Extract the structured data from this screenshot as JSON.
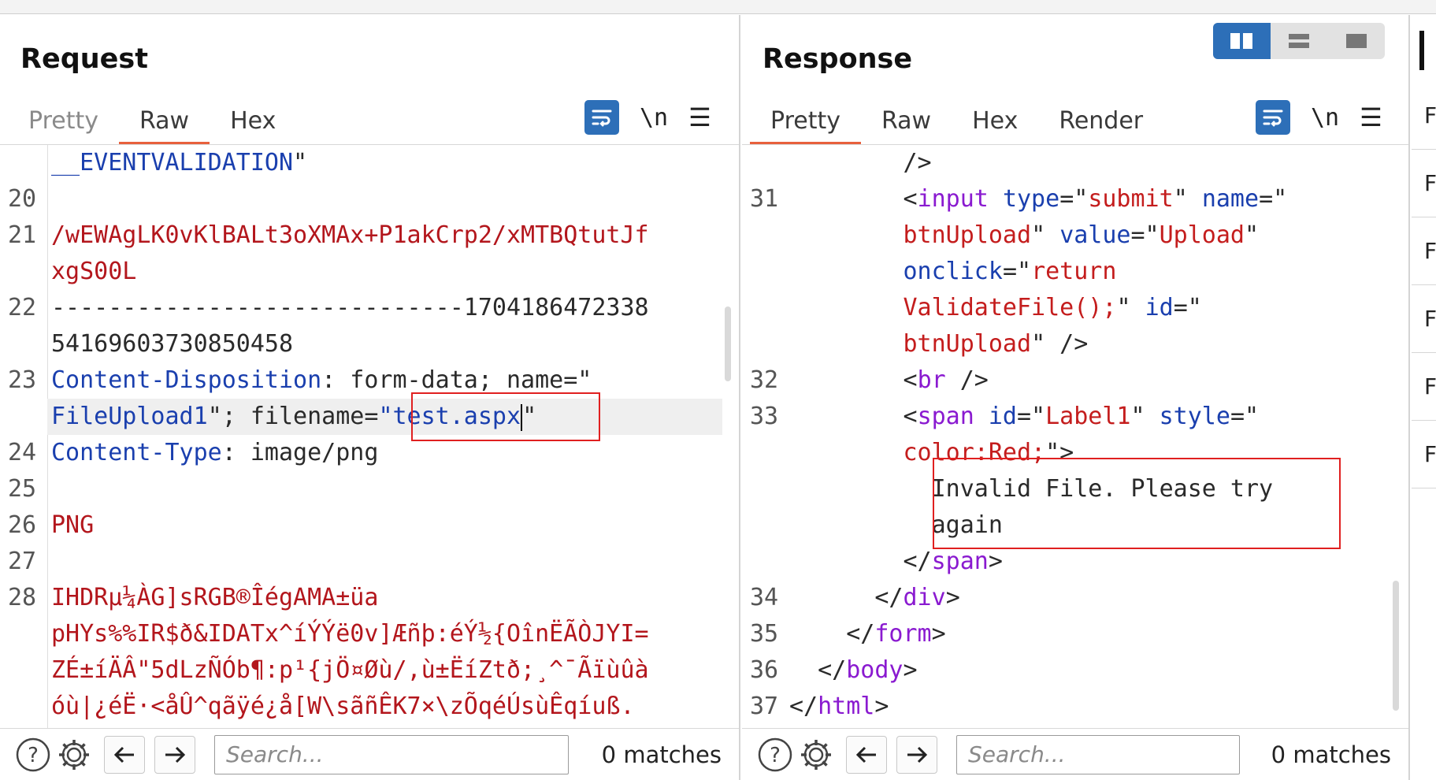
{
  "request": {
    "title": "Request",
    "tabs": [
      {
        "label": "Pretty",
        "state": "muted"
      },
      {
        "label": "Raw",
        "state": "active"
      },
      {
        "label": "Hex",
        "state": "normal"
      }
    ],
    "newline_label": "\\n",
    "lines": [
      {
        "num": "",
        "segments": [
          {
            "t": "__EVENTVALIDATION",
            "c": "blue"
          },
          {
            "t": "\"",
            "c": "dark"
          }
        ]
      },
      {
        "num": "20",
        "segments": []
      },
      {
        "num": "21",
        "segments": [
          {
            "t": "/wEWAgLK0vKlBALt3oXMAx+P1akCrp2/xMTBQtutJf",
            "c": "red"
          }
        ]
      },
      {
        "num": "",
        "segments": [
          {
            "t": "xgS00L",
            "c": "red"
          }
        ]
      },
      {
        "num": "22",
        "segments": [
          {
            "t": "-----------------------------1704186472338",
            "c": "dark"
          }
        ]
      },
      {
        "num": "",
        "segments": [
          {
            "t": "54169603730850458",
            "c": "dark"
          }
        ]
      },
      {
        "num": "23",
        "segments": [
          {
            "t": "Content-Disposition",
            "c": "blue"
          },
          {
            "t": ": form-data; name=\"",
            "c": "dark"
          }
        ]
      },
      {
        "num": "",
        "segments": [
          {
            "t": "FileUpload1",
            "c": "blue"
          },
          {
            "t": "\"; filename=",
            "c": "dark"
          },
          {
            "t": "\"test.aspx",
            "c": "blue"
          },
          {
            "t": "CARET",
            "c": "caret"
          },
          {
            "t": "\"",
            "c": "dark"
          }
        ]
      },
      {
        "num": "24",
        "segments": [
          {
            "t": "Content-Type",
            "c": "blue"
          },
          {
            "t": ": image/png",
            "c": "dark"
          }
        ]
      },
      {
        "num": "25",
        "segments": []
      },
      {
        "num": "26",
        "segments": [
          {
            "t": "PNG",
            "c": "red"
          }
        ]
      },
      {
        "num": "27",
        "segments": []
      },
      {
        "num": "28",
        "segments": [
          {
            "t": "IHDRµ¼ÀG]sRGB®ÎégAMA±üa",
            "c": "red"
          }
        ]
      },
      {
        "num": "",
        "segments": [
          {
            "t": "pHYs%%IR$ð&IDATx^íÝÝë0v]Æñþ:éÝ½{OînËÃÒJYI=",
            "c": "red"
          }
        ]
      },
      {
        "num": "",
        "segments": [
          {
            "t": "ZÉ±íÄÂ\"5dLzÑÓb¶:p¹{jÖ¤Øù/,ù±ËíZtð;¸^¯Ãïùûà",
            "c": "red"
          }
        ]
      },
      {
        "num": "",
        "segments": [
          {
            "t": "óù|¿éË·<åÛ^qãÿé¿å[W\\sãñÊK7×\\zÕqéÚsùÊqíuß.",
            "c": "red"
          }
        ]
      }
    ],
    "search_placeholder": "Search...",
    "matches": "0 matches"
  },
  "response": {
    "title": "Response",
    "tabs": [
      {
        "label": "Pretty",
        "state": "active"
      },
      {
        "label": "Raw",
        "state": "normal"
      },
      {
        "label": "Hex",
        "state": "normal"
      },
      {
        "label": "Render",
        "state": "normal"
      }
    ],
    "newline_label": "\\n",
    "lines": [
      {
        "num": "",
        "segments": [
          {
            "t": "        />",
            "c": "dark"
          }
        ]
      },
      {
        "num": "31",
        "segments": [
          {
            "t": "        <",
            "c": "dark"
          },
          {
            "t": "input",
            "c": "purple"
          },
          {
            "t": " ",
            "c": "dark"
          },
          {
            "t": "type",
            "c": "blue"
          },
          {
            "t": "=\"",
            "c": "dark"
          },
          {
            "t": "submit",
            "c": "redtxt"
          },
          {
            "t": "\" ",
            "c": "dark"
          },
          {
            "t": "name",
            "c": "blue"
          },
          {
            "t": "=\"",
            "c": "dark"
          }
        ]
      },
      {
        "num": "",
        "segments": [
          {
            "t": "        ",
            "c": "dark"
          },
          {
            "t": "btnUpload",
            "c": "redtxt"
          },
          {
            "t": "\" ",
            "c": "dark"
          },
          {
            "t": "value",
            "c": "blue"
          },
          {
            "t": "=\"",
            "c": "dark"
          },
          {
            "t": "Upload",
            "c": "redtxt"
          },
          {
            "t": "\"",
            "c": "dark"
          }
        ]
      },
      {
        "num": "",
        "segments": [
          {
            "t": "        ",
            "c": "dark"
          },
          {
            "t": "onclick",
            "c": "blue"
          },
          {
            "t": "=\"",
            "c": "dark"
          },
          {
            "t": "return",
            "c": "redtxt"
          }
        ]
      },
      {
        "num": "",
        "segments": [
          {
            "t": "        ",
            "c": "dark"
          },
          {
            "t": "ValidateFile();",
            "c": "redtxt"
          },
          {
            "t": "\" ",
            "c": "dark"
          },
          {
            "t": "id",
            "c": "blue"
          },
          {
            "t": "=\"",
            "c": "dark"
          }
        ]
      },
      {
        "num": "",
        "segments": [
          {
            "t": "        ",
            "c": "dark"
          },
          {
            "t": "btnUpload",
            "c": "redtxt"
          },
          {
            "t": "\" />",
            "c": "dark"
          }
        ]
      },
      {
        "num": "32",
        "segments": [
          {
            "t": "        <",
            "c": "dark"
          },
          {
            "t": "br",
            "c": "purple"
          },
          {
            "t": " />",
            "c": "dark"
          }
        ]
      },
      {
        "num": "33",
        "segments": [
          {
            "t": "        <",
            "c": "dark"
          },
          {
            "t": "span",
            "c": "purple"
          },
          {
            "t": " ",
            "c": "dark"
          },
          {
            "t": "id",
            "c": "blue"
          },
          {
            "t": "=\"",
            "c": "dark"
          },
          {
            "t": "Label1",
            "c": "redtxt"
          },
          {
            "t": "\" ",
            "c": "dark"
          },
          {
            "t": "style",
            "c": "blue"
          },
          {
            "t": "=\"",
            "c": "dark"
          }
        ]
      },
      {
        "num": "",
        "segments": [
          {
            "t": "        ",
            "c": "dark"
          },
          {
            "t": "color:Red;",
            "c": "redtxt"
          },
          {
            "t": "\">",
            "c": "dark"
          }
        ]
      },
      {
        "num": "",
        "segments": [
          {
            "t": "          Invalid File. Please try",
            "c": "dark"
          }
        ]
      },
      {
        "num": "",
        "segments": [
          {
            "t": "          again",
            "c": "dark"
          }
        ]
      },
      {
        "num": "",
        "segments": [
          {
            "t": "        </",
            "c": "dark"
          },
          {
            "t": "span",
            "c": "purple"
          },
          {
            "t": ">",
            "c": "dark"
          }
        ]
      },
      {
        "num": "34",
        "segments": [
          {
            "t": "      </",
            "c": "dark"
          },
          {
            "t": "div",
            "c": "purple"
          },
          {
            "t": ">",
            "c": "dark"
          }
        ]
      },
      {
        "num": "35",
        "segments": [
          {
            "t": "    </",
            "c": "dark"
          },
          {
            "t": "form",
            "c": "purple"
          },
          {
            "t": ">",
            "c": "dark"
          }
        ]
      },
      {
        "num": "36",
        "segments": [
          {
            "t": "  </",
            "c": "dark"
          },
          {
            "t": "body",
            "c": "purple"
          },
          {
            "t": ">",
            "c": "dark"
          }
        ]
      },
      {
        "num": "37",
        "segments": [
          {
            "t": "</",
            "c": "dark"
          },
          {
            "t": "html",
            "c": "purple"
          },
          {
            "t": ">",
            "c": "dark"
          }
        ]
      }
    ],
    "search_placeholder": "Search...",
    "matches": "0 matches"
  },
  "side_panel": {
    "items": [
      "F",
      "F",
      "F",
      "F",
      "F",
      "F"
    ]
  },
  "colors": {
    "accent_tab": "#e8603c",
    "highlight_box": "#e02020",
    "toggle_active": "#2d6fb8"
  },
  "icons": {
    "wrap": "wrap-lines-icon",
    "help": "help-circle-icon",
    "settings": "gear-icon",
    "back": "arrow-left-icon",
    "forward": "arrow-right-icon",
    "menu": "hamburger-menu-icon"
  }
}
